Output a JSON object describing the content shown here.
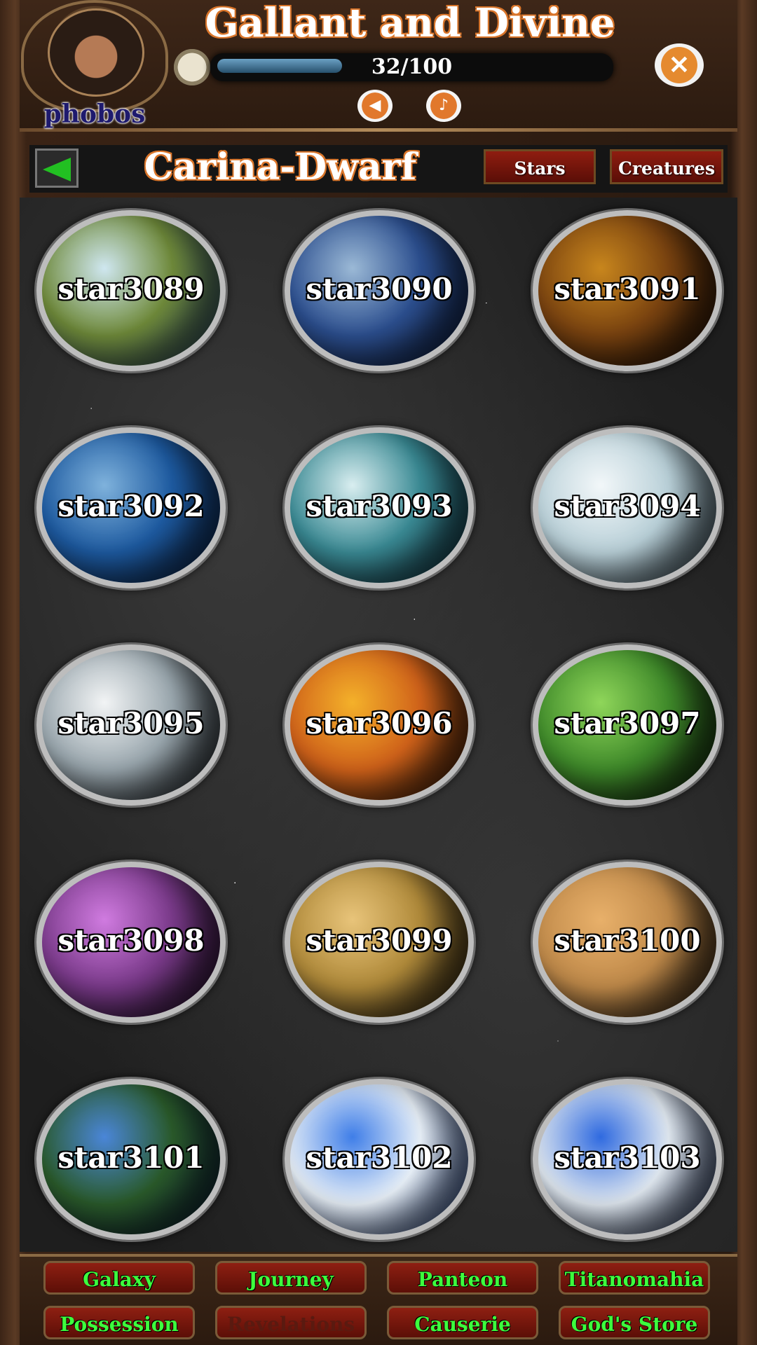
{
  "header": {
    "title": "Gallant and Divine",
    "player_name": "phobos",
    "progress_text": "32/100",
    "progress_fraction": 0.32,
    "close_icon": "close-icon",
    "sound_icon": "sound-icon",
    "music_icon": "music-icon",
    "clock_icon": "pocket-watch-icon"
  },
  "galaxy": {
    "name": "Carina-Dwarf",
    "back_icon": "back-arrow-icon",
    "tabs": [
      "Stars",
      "Creatures"
    ]
  },
  "stars": [
    {
      "label": "star3089",
      "colors": [
        "#cfe7f0",
        "#6f8a3a",
        "#2a4a6a"
      ]
    },
    {
      "label": "star3090",
      "colors": [
        "#9bb9d6",
        "#2c4f8f",
        "#0c1a3a"
      ]
    },
    {
      "label": "star3091",
      "colors": [
        "#c8861d",
        "#7a4310",
        "#1a0c05"
      ]
    },
    {
      "label": "star3092",
      "colors": [
        "#7fb2dc",
        "#1d5aa0",
        "#0a1e40"
      ]
    },
    {
      "label": "star3093",
      "colors": [
        "#d9eef0",
        "#3a8a94",
        "#0c2a38"
      ]
    },
    {
      "label": "star3094",
      "colors": [
        "#f2f7f9",
        "#b9d0d8",
        "#2a3a44"
      ]
    },
    {
      "label": "star3095",
      "colors": [
        "#f2f4f5",
        "#9aa7ae",
        "#101418"
      ]
    },
    {
      "label": "star3096",
      "colors": [
        "#f4b12a",
        "#d0621a",
        "#2a1406"
      ]
    },
    {
      "label": "star3097",
      "colors": [
        "#8fd65a",
        "#3f8a2a",
        "#0c1a08"
      ]
    },
    {
      "label": "star3098",
      "colors": [
        "#d07be0",
        "#7a3a8a",
        "#1a0c1e"
      ]
    },
    {
      "label": "star3099",
      "colors": [
        "#e8c47a",
        "#b08a3a",
        "#1a140a"
      ]
    },
    {
      "label": "star3100",
      "colors": [
        "#e8b06a",
        "#c08a4a",
        "#1a120a"
      ]
    },
    {
      "label": "star3101",
      "colors": [
        "#4a86d8",
        "#2a5a2a",
        "#0a1a3a"
      ]
    },
    {
      "label": "star3102",
      "colors": [
        "#3f7ee8",
        "#e8f0f8",
        "#0c2a6a"
      ]
    },
    {
      "label": "star3103",
      "colors": [
        "#2f6ae0",
        "#e0e8f0",
        "#0a1a40"
      ]
    }
  ],
  "bottom_nav": [
    {
      "label": "Galaxy",
      "enabled": true
    },
    {
      "label": "Journey",
      "enabled": true
    },
    {
      "label": "Panteon",
      "enabled": true
    },
    {
      "label": "Titanomahia",
      "enabled": true
    },
    {
      "label": "Possession",
      "enabled": true
    },
    {
      "label": "Revelations",
      "enabled": false
    },
    {
      "label": "Causerie",
      "enabled": true
    },
    {
      "label": "God's Store",
      "enabled": true
    }
  ]
}
